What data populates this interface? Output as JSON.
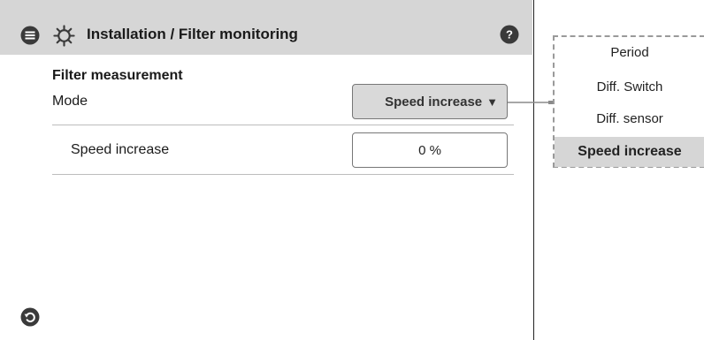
{
  "header": {
    "title": "Installation / Filter monitoring",
    "menu_icon": "menu-icon",
    "settings_icon": "gear-icon",
    "help_icon": "help-icon"
  },
  "content": {
    "section_title": "Filter measurement",
    "mode": {
      "label": "Mode",
      "value": "Speed increase",
      "arrow": "▼"
    },
    "speed_increase": {
      "label": "Speed increase",
      "value": "0 %"
    }
  },
  "footer": {
    "back_icon": "back-icon"
  },
  "mode_options": {
    "items": [
      "Period",
      "Diff. Switch",
      "Diff. sensor",
      "Speed increase"
    ],
    "selected": "Speed increase"
  },
  "colors": {
    "header_bg": "#d6d6d6",
    "icon": "#3a3a3a",
    "select_bg": "#d9d9d9"
  }
}
